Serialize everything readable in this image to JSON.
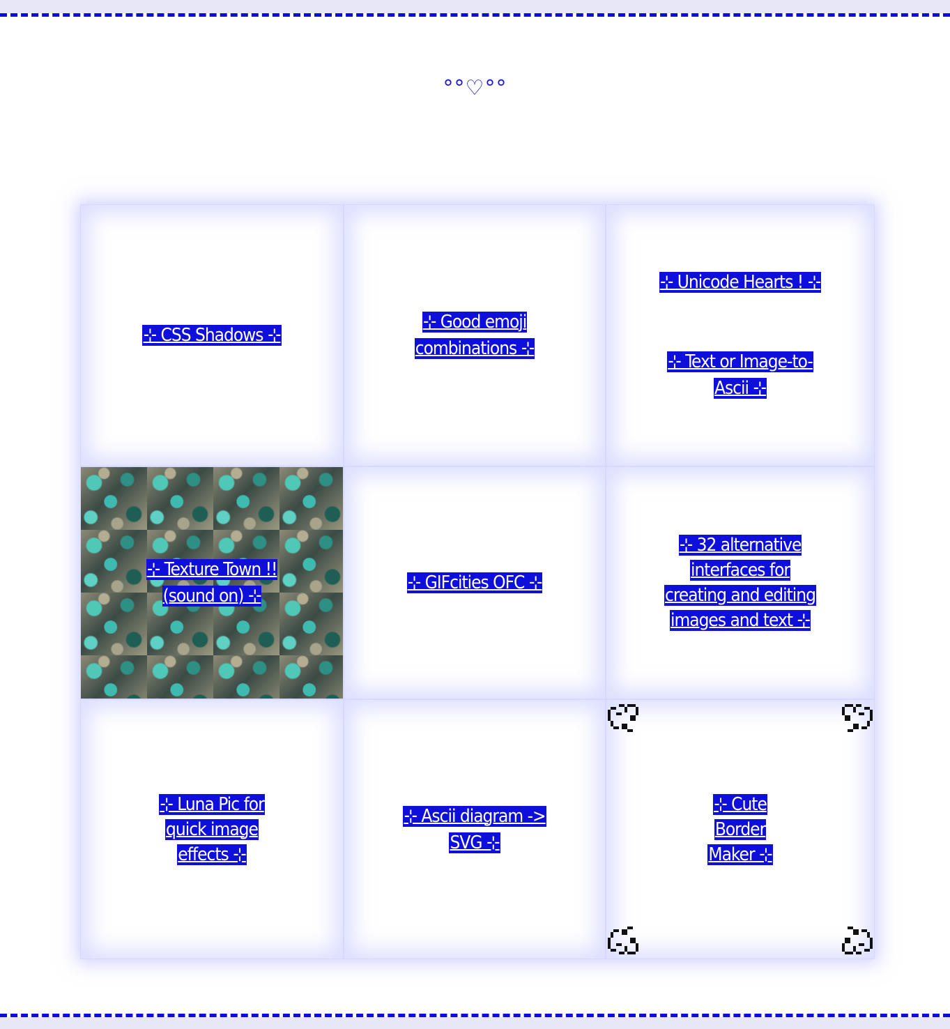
{
  "header": {
    "ornament": "°°♡°°"
  },
  "links": {
    "css_shadows": "⊹ CSS Shadows ⊹",
    "emoji": "⊹ Good emoji combinations ⊹",
    "hearts": "⊹ Unicode Hearts ! ⊹",
    "ascii_text": "⊹ Text or Image-to-Ascii ⊹",
    "texture_town": "⊹ Texture Town !! (sound on) ⊹",
    "gifcities": "⊹ GIFcities OFC ⊹",
    "alt_interfaces": "⊹ 32 alternative interfaces for creating and editing images and text ⊹",
    "luna_pic": "⊹ Luna Pic for quick image effects ⊹",
    "ascii_svg": "⊹ Ascii diagram -> SVG ⊹",
    "border_maker": "⊹ Cute Border Maker ⊹"
  },
  "colors": {
    "link_bg": "#0f0fdc",
    "border_dash": "#0d0ddb",
    "grid_glow": "#c9cbff"
  },
  "icons": {
    "corner": "pixel-heart-corner-icon"
  }
}
